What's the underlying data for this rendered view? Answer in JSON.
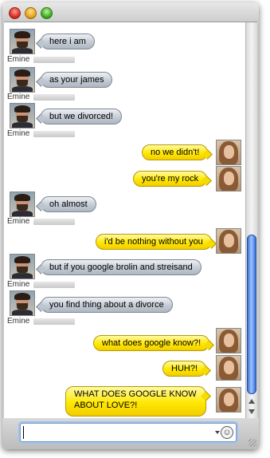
{
  "window": {
    "title": ""
  },
  "sender_name": "Emine",
  "messages": [
    {
      "from": "Emine",
      "text": "here i am"
    },
    {
      "from": "Emine",
      "text": "as your james"
    },
    {
      "from": "Emine",
      "text": "but we divorced!"
    },
    {
      "from": "me",
      "text": "no we didn't!"
    },
    {
      "from": "me",
      "text": "you're my rock"
    },
    {
      "from": "Emine",
      "text": "oh almost"
    },
    {
      "from": "me",
      "text": "i'd be nothing without you"
    },
    {
      "from": "Emine",
      "text": "but if you google brolin and streisand"
    },
    {
      "from": "Emine",
      "text": "you find thing about a divorce"
    },
    {
      "from": "me",
      "text": "what does google know?!"
    },
    {
      "from": "me",
      "text": "HUH?!"
    },
    {
      "from": "me",
      "text": "WHAT DOES GOOGLE KNOW ABOUT LOVE?!"
    }
  ],
  "compose": {
    "value": "",
    "emoticon": "☺"
  },
  "icons": [
    "close-icon",
    "minimize-icon",
    "zoom-icon",
    "dropdown-arrow-icon",
    "smiley-icon",
    "resize-grip-icon"
  ],
  "colors": {
    "outgoing_bubble": "#ffe800",
    "incoming_bubble": "#c4cbd4",
    "scroll_thumb": "#2a62cf"
  }
}
